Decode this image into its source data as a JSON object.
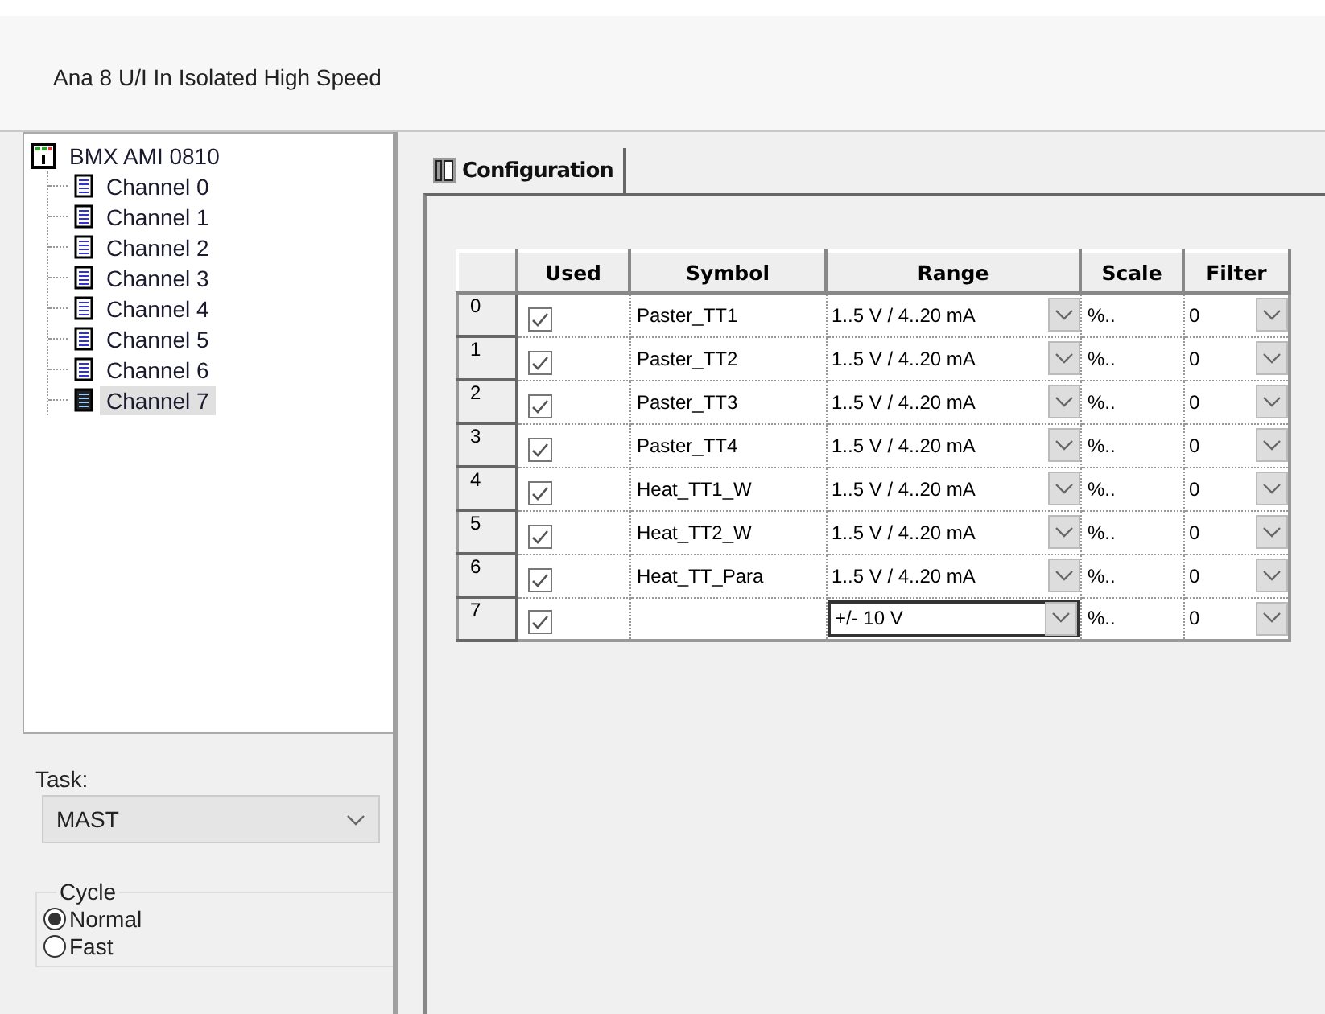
{
  "header": {
    "title": "Ana 8 U/I In Isolated High Speed"
  },
  "tree": {
    "root": {
      "label": "BMX AMI 0810",
      "children": [
        {
          "label": "Channel 0",
          "selected": false
        },
        {
          "label": "Channel 1",
          "selected": false
        },
        {
          "label": "Channel 2",
          "selected": false
        },
        {
          "label": "Channel 3",
          "selected": false
        },
        {
          "label": "Channel 4",
          "selected": false
        },
        {
          "label": "Channel 5",
          "selected": false
        },
        {
          "label": "Channel 6",
          "selected": false
        },
        {
          "label": "Channel 7",
          "selected": true
        }
      ]
    }
  },
  "task": {
    "label": "Task:",
    "value": "MAST"
  },
  "cycle": {
    "legend": "Cycle",
    "options": [
      {
        "label": "Normal",
        "selected": true
      },
      {
        "label": "Fast",
        "selected": false
      }
    ]
  },
  "tabs": [
    {
      "label": "Configuration",
      "selected": true
    }
  ],
  "table": {
    "columns": [
      "Used",
      "Symbol",
      "Range",
      "Scale",
      "Filter"
    ],
    "rows": [
      {
        "index": "0",
        "used": true,
        "symbol": "Paster_TT1",
        "range": "1..5 V / 4..20 mA",
        "scale": "%..",
        "filter": "0",
        "focused": false
      },
      {
        "index": "1",
        "used": true,
        "symbol": "Paster_TT2",
        "range": "1..5 V / 4..20 mA",
        "scale": "%..",
        "filter": "0",
        "focused": false
      },
      {
        "index": "2",
        "used": true,
        "symbol": "Paster_TT3",
        "range": "1..5 V / 4..20 mA",
        "scale": "%..",
        "filter": "0",
        "focused": false
      },
      {
        "index": "3",
        "used": true,
        "symbol": "Paster_TT4",
        "range": "1..5 V / 4..20 mA",
        "scale": "%..",
        "filter": "0",
        "focused": false
      },
      {
        "index": "4",
        "used": true,
        "symbol": "Heat_TT1_W",
        "range": "1..5 V / 4..20 mA",
        "scale": "%..",
        "filter": "0",
        "focused": false
      },
      {
        "index": "5",
        "used": true,
        "symbol": "Heat_TT2_W",
        "range": "1..5 V / 4..20 mA",
        "scale": "%..",
        "filter": "0",
        "focused": false
      },
      {
        "index": "6",
        "used": true,
        "symbol": "Heat_TT_Para",
        "range": "1..5 V / 4..20 mA",
        "scale": "%..",
        "filter": "0",
        "focused": false
      },
      {
        "index": "7",
        "used": true,
        "symbol": "",
        "range": "+/- 10 V",
        "scale": "%..",
        "filter": "0",
        "focused": true
      }
    ]
  }
}
